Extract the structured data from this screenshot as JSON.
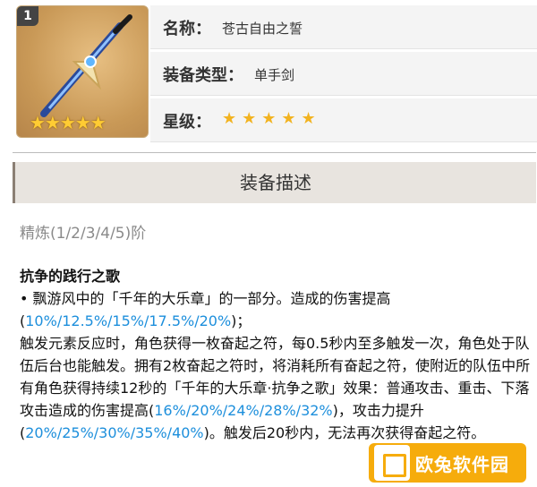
{
  "weapon": {
    "rank_badge": "1",
    "image_stars": "★★★★★",
    "name_label": "名称：",
    "name_value": "苍古自由之誓",
    "type_label": "装备类型：",
    "type_value": "单手剑",
    "star_label": "星级：",
    "star_value": "★★★★★"
  },
  "section": {
    "title": "装备描述"
  },
  "refine_text": "精炼(1/2/3/4/5)阶",
  "description": {
    "title": "抗争的践行之歌",
    "line1_a": " • 飘游风中的「千年的大乐章」的一部分。造成的伤害提高(",
    "line1_hl": "10%/12.5%/15%/17.5%/20%",
    "line1_b": ")；",
    "p2_a": "触发元素反应时，角色获得一枚奋起之符，每0.5秒内至多触发一次，角色处于队伍后台也能触发。拥有2枚奋起之符时，将消耗所有奋起之符，使附近的队伍中所有角色获得持续12秒的「千年的大乐章·抗争之歌」效果：普通攻击、重击、下落攻击造成的伤害提高(",
    "p2_hl1": "16%/20%/24%/28%/32%",
    "p2_b": ")，攻击力提升(",
    "p2_hl2": "20%/25%/30%/35%/40%",
    "p2_c": ")。触发后20秒内，无法再次获得奋起之符。"
  },
  "watermark": {
    "text": "欧兔软件园"
  }
}
